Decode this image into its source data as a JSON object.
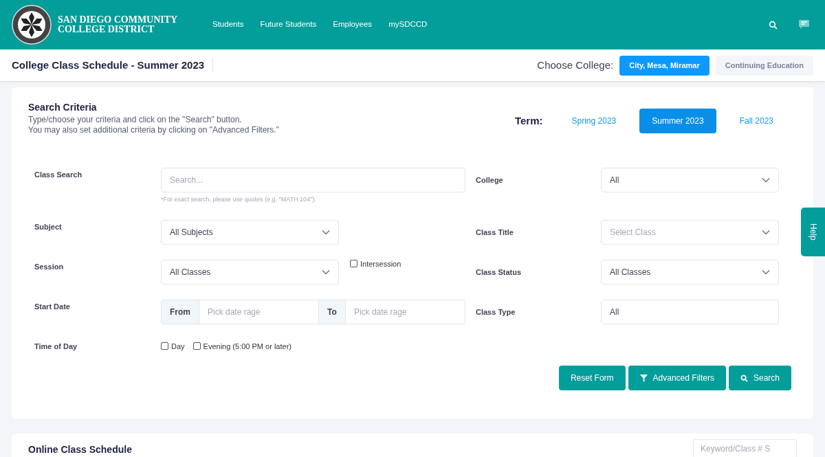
{
  "header": {
    "logo_text": "SAN DIEGO COMMUNITY COLLEGE DISTRICT",
    "nav": [
      "Students",
      "Future Students",
      "Employees",
      "mySDCCD"
    ]
  },
  "subheader": {
    "title": "College Class Schedule - Summer 2023",
    "choose_label": "Choose College:",
    "colleges": [
      {
        "label": "City, Mesa, Miramar",
        "selected": true
      },
      {
        "label": "Continuing Education",
        "selected": false
      }
    ]
  },
  "search_criteria": {
    "title": "Search Criteria",
    "instructions": [
      "Type/choose your criteria and click on the \"Search\" button.",
      "You may also set additional criteria by clicking on \"Advanced Filters.\""
    ],
    "term_label": "Term:",
    "terms": [
      {
        "label": "Spring 2023",
        "selected": false
      },
      {
        "label": "Summer 2023",
        "selected": true
      },
      {
        "label": "Fall 2023",
        "selected": false
      }
    ],
    "rows": [
      {
        "left": {
          "label": "Class Search",
          "control": {
            "kind": "text",
            "placeholder": "Search...",
            "hint": "*For exact search, please use quotes (e.g. \"MATH 104\")."
          }
        },
        "right": {
          "label": "College",
          "control": {
            "kind": "select",
            "value": "All"
          }
        }
      },
      {
        "left": {
          "label": "Subject",
          "control": {
            "kind": "select",
            "value": "All Subjects"
          }
        },
        "right": {
          "label": "Class Title",
          "control": {
            "kind": "select",
            "placeholder": "Select Class"
          }
        }
      },
      {
        "left": {
          "label": "Session",
          "control": {
            "kind": "select",
            "value": "All Classes"
          },
          "checkbox": {
            "label": "Intersession",
            "checked": false
          }
        },
        "right": {
          "label": "Class Status",
          "control": {
            "kind": "select",
            "value": "All Classes"
          }
        }
      },
      {
        "left": {
          "label": "Start Date",
          "control": {
            "kind": "daterange",
            "from_label": "From",
            "from_placeholder": "Pick date rage",
            "to_label": "To",
            "to_placeholder": "Pick date rage"
          }
        },
        "right": {
          "label": "Class Type",
          "control": {
            "kind": "text",
            "value": "All"
          }
        }
      },
      {
        "left": {
          "label": "Time of Day",
          "control": {
            "kind": "checkboxes",
            "options": [
              {
                "label": "Day",
                "checked": false
              },
              {
                "label": "Evening (5:00 PM or later)",
                "checked": false
              }
            ]
          }
        }
      }
    ],
    "buttons": [
      {
        "kind": "reset",
        "label": "Reset Form"
      },
      {
        "kind": "filter",
        "label": "Advanced Filters"
      },
      {
        "kind": "search",
        "label": "Search"
      }
    ]
  },
  "online_schedule": {
    "title": "Online Class Schedule",
    "keyword_placeholder": "Keyword/Class # S"
  },
  "help_tab": "Help"
}
